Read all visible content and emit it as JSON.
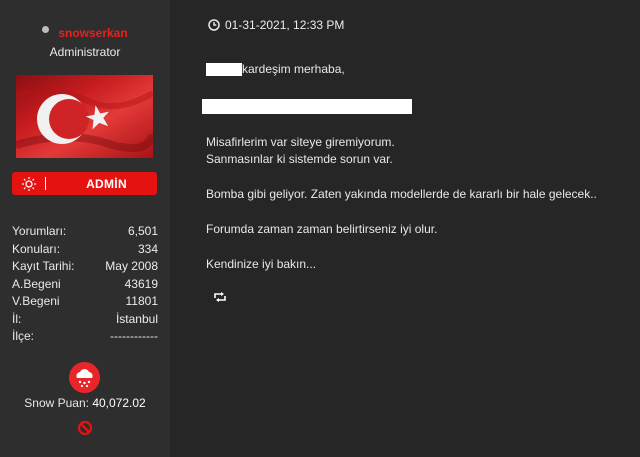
{
  "user": {
    "username": "snowserkan",
    "role": "Administrator",
    "badge_label": "ADMİN",
    "stats": [
      {
        "label": "Yorumları:",
        "value": "6,501"
      },
      {
        "label": "Konuları:",
        "value": "334"
      },
      {
        "label": "Kayıt Tarihi:",
        "value": "May 2008"
      },
      {
        "label": "A.Begeni",
        "value": "43619"
      },
      {
        "label": "V.Begeni",
        "value": "11801"
      },
      {
        "label": "İl:",
        "value": "İstanbul"
      },
      {
        "label": "İlçe:",
        "value": "------------"
      }
    ],
    "snow_label": "Snow Puan:",
    "snow_value": "40,072.02"
  },
  "post": {
    "date": "01-31-2021, 12:33 PM",
    "greeting_suffix": "kardeşim merhaba,",
    "line1": "Misafirlerim var siteye giremiyorum.",
    "line2": "Sanmasınlar ki sistemde sorun var.",
    "line3": "Bomba gibi geliyor. Zaten yakında modellerde de kararlı bir hale gelecek..",
    "line4": "Forumda zaman zaman belirtirseniz iyi olur.",
    "line5": "Kendinize iyi bakın..."
  },
  "colors": {
    "accent_red": "#e51212",
    "username_red": "#e8211f",
    "background": "#262626",
    "sidebar": "#2e2e2e"
  },
  "icons": [
    "status-dot",
    "turkish-flag",
    "sun-icon",
    "snowflake-cloud-icon",
    "ban-icon",
    "clock-icon",
    "retweet-icon"
  ]
}
